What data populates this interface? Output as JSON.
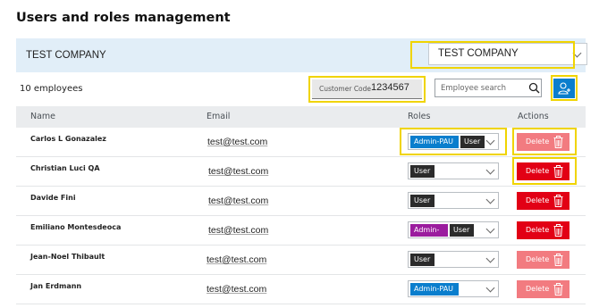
{
  "page": {
    "title": "Users and roles management"
  },
  "company": {
    "name": "TEST COMPANY",
    "selected": "TEST COMPANY"
  },
  "toolbar": {
    "employee_count": "10 employees",
    "customer_code_label": "Customer Code",
    "customer_code": "1234567",
    "search_placeholder": "Employee search",
    "add_user_icon": "add-user-icon"
  },
  "table": {
    "headers": {
      "name": "Name",
      "email": "Email",
      "roles": "Roles",
      "actions": "Actions"
    },
    "delete_label": "Delete",
    "rows": [
      {
        "name": "Carlos L Gonazalez",
        "email": "test@test.com",
        "roles": [
          "Admin-PAU",
          "User"
        ],
        "delete_state": "disabled"
      },
      {
        "name": "Christian Luci QA",
        "email": "test@test.com",
        "roles": [
          "User"
        ],
        "delete_state": "active"
      },
      {
        "name": "Davide Fini",
        "email": "test@test.com",
        "roles": [
          "User"
        ],
        "delete_state": "active"
      },
      {
        "name": "Emiliano Montesdeoca",
        "email": "test@test.com",
        "roles": [
          "Admin-U",
          "User"
        ],
        "delete_state": "active"
      },
      {
        "name": "Jean-Noel Thibault",
        "email": "test@test.com",
        "roles": [
          "User"
        ],
        "delete_state": "disabled"
      },
      {
        "name": "Jan Erdmann",
        "email": "test@test.com",
        "roles": [
          "Admin-PAU"
        ],
        "delete_state": "disabled"
      }
    ]
  },
  "colors": {
    "accent_blue": "#0a7ecd",
    "role_admin_pau": "#0a7ecd",
    "role_admin_u": "#9b1c9e",
    "role_user": "#2b2b2b",
    "delete_active": "#e20015",
    "delete_disabled": "#f27b80",
    "highlight": "#f0d400"
  }
}
